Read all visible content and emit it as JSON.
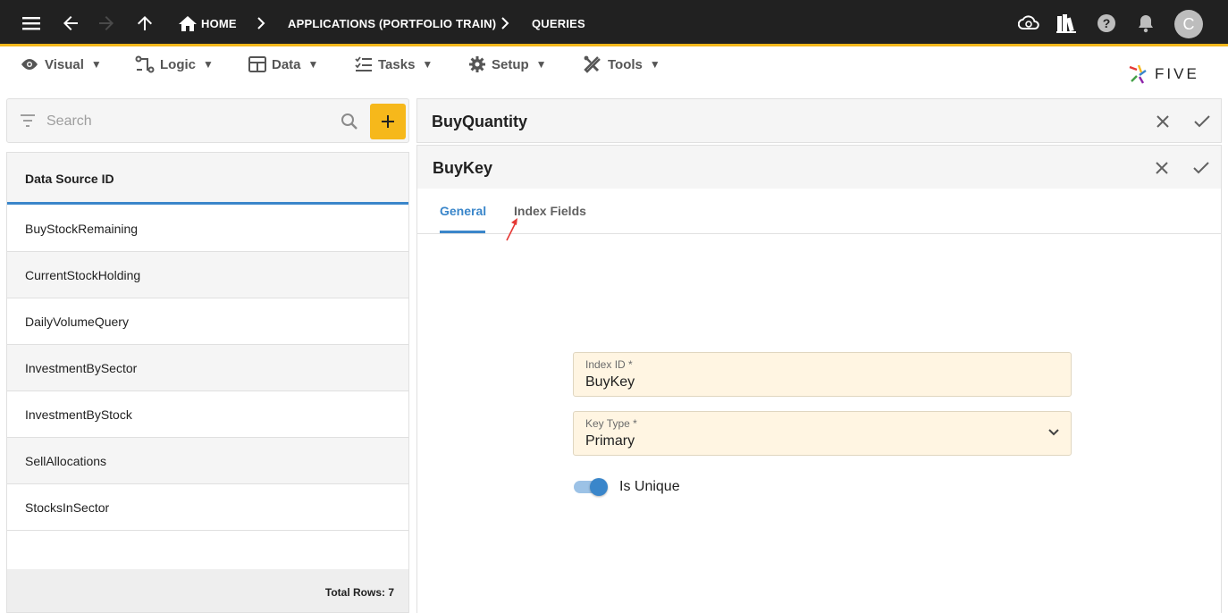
{
  "topbar": {
    "breadcrumb": {
      "home": "HOME",
      "applications": "APPLICATIONS (PORTFOLIO TRAIN)",
      "queries": "QUERIES"
    },
    "avatar_initial": "C",
    "icons": [
      "menu-icon",
      "back-arrow-icon",
      "forward-arrow-icon",
      "up-arrow-icon",
      "home-icon",
      "cloud-icon",
      "books-icon",
      "help-icon",
      "bell-icon"
    ],
    "accent_color": "#f6b81b"
  },
  "menubar": {
    "items": [
      {
        "label": "Visual",
        "icon": "eye-icon"
      },
      {
        "label": "Logic",
        "icon": "logic-icon"
      },
      {
        "label": "Data",
        "icon": "table-icon"
      },
      {
        "label": "Tasks",
        "icon": "checklist-icon"
      },
      {
        "label": "Setup",
        "icon": "gear-icon"
      },
      {
        "label": "Tools",
        "icon": "tools-icon"
      }
    ],
    "logo_text": "FIVE"
  },
  "left_panel": {
    "search_placeholder": "Search",
    "column_header": "Data Source ID",
    "rows": [
      "BuyStockRemaining",
      "CurrentStockHolding",
      "DailyVolumeQuery",
      "InvestmentBySector",
      "InvestmentByStock",
      "SellAllocations",
      "StocksInSector"
    ],
    "footer": "Total Rows: 7"
  },
  "right_panel": {
    "parent_title": "BuyQuantity",
    "form_title": "BuyKey",
    "tabs": [
      {
        "label": "General",
        "active": true
      },
      {
        "label": "Index Fields",
        "active": false
      }
    ],
    "fields": {
      "index_id": {
        "label": "Index ID *",
        "value": "BuyKey"
      },
      "key_type": {
        "label": "Key Type *",
        "value": "Primary"
      }
    },
    "is_unique": {
      "label": "Is Unique",
      "checked": true
    },
    "active_color": "#3a86ca",
    "required_field_bg": "#fff5e2"
  }
}
